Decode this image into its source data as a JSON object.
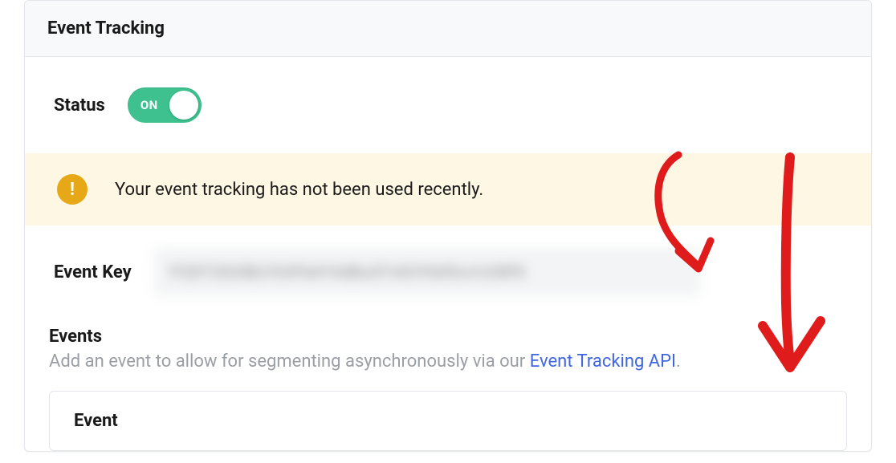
{
  "panel": {
    "title": "Event Tracking"
  },
  "status": {
    "label": "Status",
    "toggle_text": "ON"
  },
  "alert": {
    "icon_glyph": "!",
    "message": "Your event tracking has not been used recently."
  },
  "event_key": {
    "label": "Event Key",
    "value_obscured": "P2DT3IS3BLYS3Fb6Y4dBuSTvK3Yb0Sru%2Wf5"
  },
  "events": {
    "heading": "Events",
    "description_prefix": "Add an event to allow for segmenting asynchronously via our ",
    "link_text": "Event Tracking API",
    "description_suffix": "."
  },
  "subpanel": {
    "title": "Event"
  }
}
